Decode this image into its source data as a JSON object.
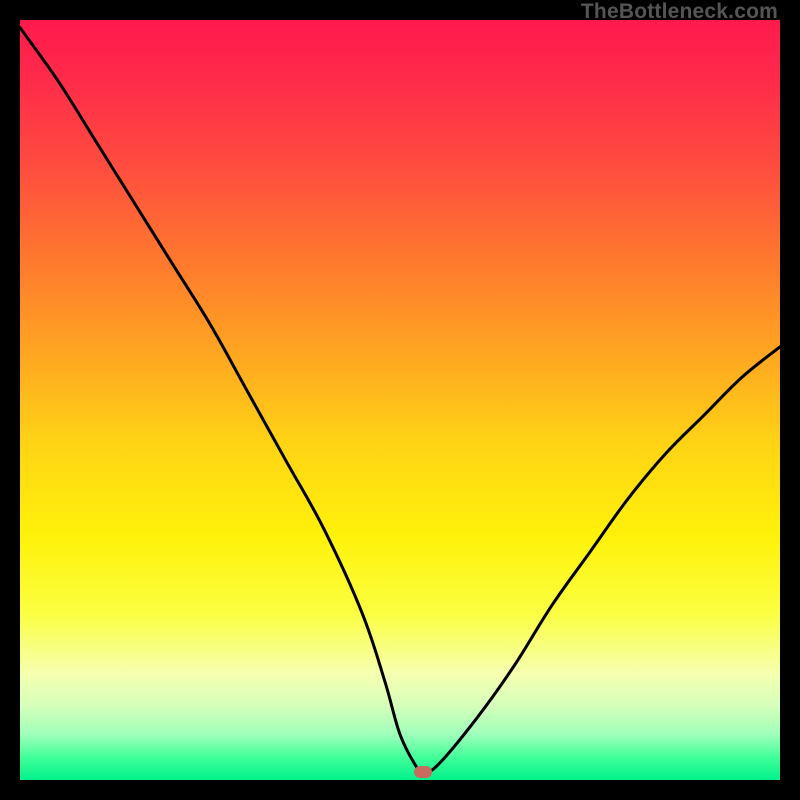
{
  "watermark": "TheBottleneck.com",
  "colors": {
    "page_bg": "#000000",
    "curve_stroke": "#000000",
    "marker_fill": "#c86a60"
  },
  "chart_data": {
    "type": "line",
    "title": "",
    "xlabel": "",
    "ylabel": "",
    "xlim": [
      0,
      100
    ],
    "ylim": [
      0,
      100
    ],
    "grid": false,
    "annotations": [],
    "marker": {
      "x": 53,
      "y": 1
    },
    "series": [
      {
        "name": "bottleneck-curve",
        "x": [
          0,
          5,
          10,
          15,
          20,
          25,
          30,
          35,
          40,
          45,
          48,
          50,
          52,
          53,
          55,
          60,
          65,
          70,
          75,
          80,
          85,
          90,
          95,
          100
        ],
        "values": [
          99,
          92,
          84,
          76,
          68,
          60,
          51,
          42,
          33,
          22,
          13,
          6,
          2,
          1,
          2,
          8,
          15,
          23,
          30,
          37,
          43,
          48,
          53,
          57
        ]
      }
    ]
  }
}
